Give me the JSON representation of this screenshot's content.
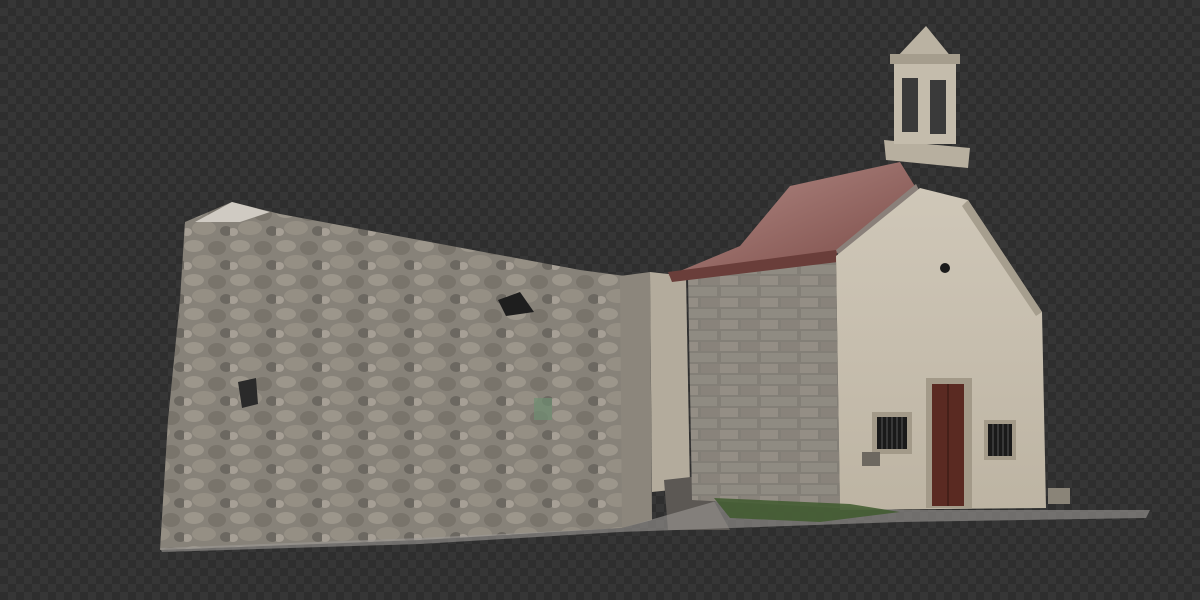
{
  "scene": {
    "subject": "",
    "background": "transparency-checkerboard",
    "colors": {
      "checker_dark": "#2e2e2e",
      "checker_light": "#363636",
      "stone_wall": "#9a948a",
      "stone_shadow": "#6e6a64",
      "plaster_facade": "#c9c2b3",
      "roof_tile": "#8a5a56",
      "door_wood": "#5a2a22",
      "window_grate": "#1a1a1a",
      "grass": "#3f5a2e"
    },
    "icons": [
      "bell-tower-icon",
      "door-icon",
      "window-icon",
      "oculus-icon"
    ]
  }
}
